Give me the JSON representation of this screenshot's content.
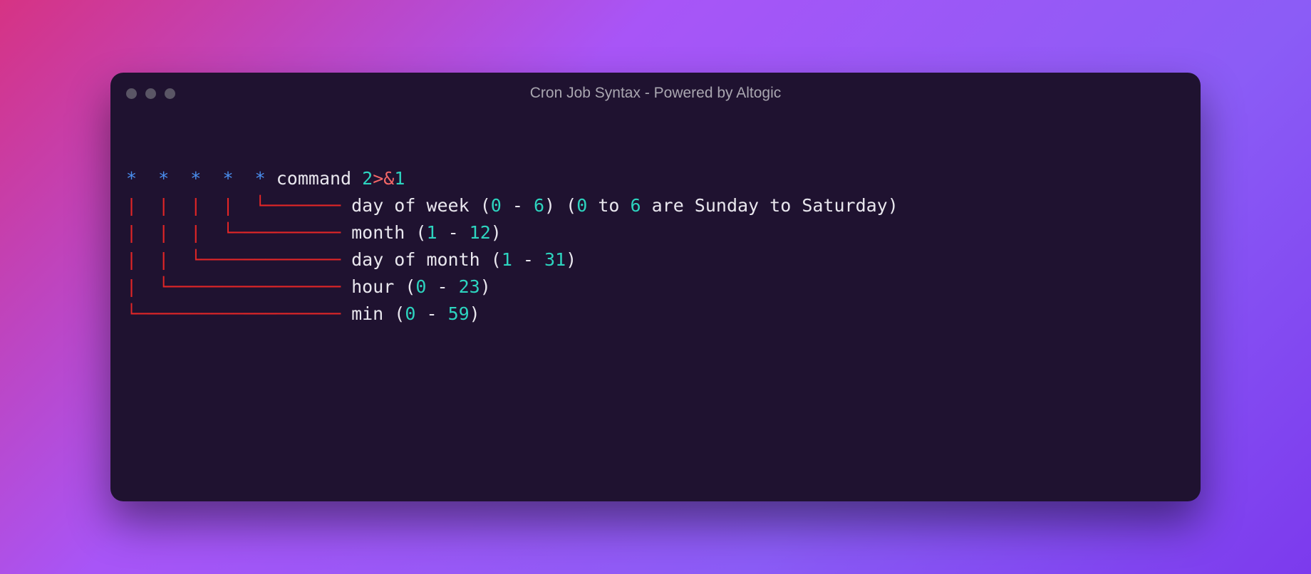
{
  "window": {
    "title": "Cron Job Syntax - Powered by Altogic"
  },
  "code": {
    "line1": {
      "stars": "*  *  *  *  *",
      "command": "command",
      "redirect_num": "2",
      "redirect_gt": ">",
      "redirect_amp": "&",
      "redirect_one": "1"
    },
    "line2": {
      "pipes": "|  |  |  |  ",
      "branch": "└─────── ",
      "label_pre": "day of week (",
      "n1": "0",
      "dash1": " - ",
      "n2": "6",
      "mid": ") (",
      "n3": "0",
      "to": " to ",
      "n4": "6",
      "tail": " are Sunday to Saturday)"
    },
    "line3": {
      "pipes": "|  |  |  ",
      "branch": "└────────── ",
      "label_pre": "month (",
      "n1": "1",
      "dash": " - ",
      "n2": "12",
      "close": ")"
    },
    "line4": {
      "pipes": "|  |  ",
      "branch": "└───────────── ",
      "label_pre": "day of month (",
      "n1": "1",
      "dash": " - ",
      "n2": "31",
      "close": ")"
    },
    "line5": {
      "pipes": "|  ",
      "branch": "└──────────────── ",
      "label_pre": "hour (",
      "n1": "0",
      "dash": " - ",
      "n2": "23",
      "close": ")"
    },
    "line6": {
      "pipes": "",
      "branch": "└─────────────────── ",
      "label_pre": "min (",
      "n1": "0",
      "dash": " - ",
      "n2": "59",
      "close": ")"
    }
  }
}
